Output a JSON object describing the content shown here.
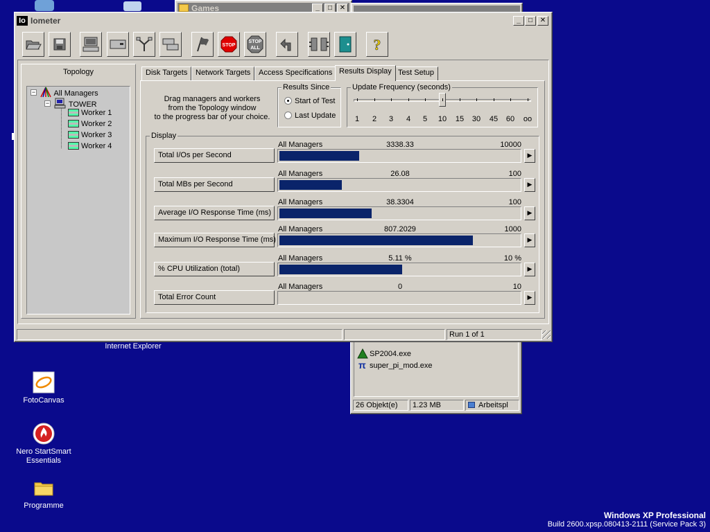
{
  "desktop": {
    "icons": {
      "internet_explorer": "Internet Explorer",
      "fotocanvas": "FotoCanvas",
      "nero": "Nero StartSmart Essentials",
      "programme": "Programme"
    },
    "brand": {
      "line1": "Windows XP Professional",
      "line2": "Build 2600.xpsp.080413-2111 (Service Pack 3)"
    }
  },
  "bg_window_games": {
    "title": "Games"
  },
  "explorer_window": {
    "files": [
      "SP2004.exe",
      "super_pi_mod.exe"
    ],
    "status": {
      "objects": "26 Objekt(e)",
      "size": "1.23 MB",
      "location": "Arbeitspl"
    }
  },
  "iometer": {
    "logo": "Io",
    "title": "Iometer",
    "caption_buttons": {
      "minimize": "_",
      "maximize": "□",
      "close": "✕"
    },
    "toolbar_glyphs": {
      "stop": "STOP",
      "stop_all_1": "STOP",
      "stop_all_2": "ALL",
      "help": "?"
    },
    "topology": {
      "title": "Topology",
      "root": "All Managers",
      "manager": "TOWER",
      "workers": [
        "Worker 1",
        "Worker 2",
        "Worker 3",
        "Worker 4"
      ]
    },
    "tabs": [
      "Disk Targets",
      "Network Targets",
      "Access Specifications",
      "Results Display",
      "Test Setup"
    ],
    "hint": [
      "Drag managers and workers",
      "from the Topology window",
      "to the progress bar of your choice."
    ],
    "results_since": {
      "title": "Results Since",
      "options": [
        "Start of Test",
        "Last Update"
      ],
      "selected": "Start of Test"
    },
    "update_frequency": {
      "title": "Update Frequency (seconds)",
      "ticks": [
        "1",
        "2",
        "3",
        "4",
        "5",
        "10",
        "15",
        "30",
        "45",
        "60",
        "oo"
      ],
      "selected_index": 5
    },
    "display": {
      "title": "Display",
      "rows": [
        {
          "label": "Total I/Os per Second",
          "source": "All Managers",
          "value": "3338.33",
          "max": "10000",
          "fraction": 0.3338
        },
        {
          "label": "Total MBs per Second",
          "source": "All Managers",
          "value": "26.08",
          "max": "100",
          "fraction": 0.2608
        },
        {
          "label": "Average I/O Response Time (ms)",
          "source": "All Managers",
          "value": "38.3304",
          "max": "100",
          "fraction": 0.3833
        },
        {
          "label": "Maximum I/O Response Time (ms)",
          "source": "All Managers",
          "value": "807.2029",
          "max": "1000",
          "fraction": 0.8072
        },
        {
          "label": "% CPU Utilization (total)",
          "source": "All Managers",
          "value": "5.11 %",
          "max": "10 %",
          "fraction": 0.511
        },
        {
          "label": "Total Error Count",
          "source": "All Managers",
          "value": "0",
          "max": "10",
          "fraction": 0
        }
      ],
      "arrow": "▶"
    },
    "status": {
      "run": "Run 1 of 1"
    }
  },
  "colors": {
    "desktop": "#0a0a8c",
    "bar_fill": "#0a246a",
    "face": "#d4d0c8"
  }
}
